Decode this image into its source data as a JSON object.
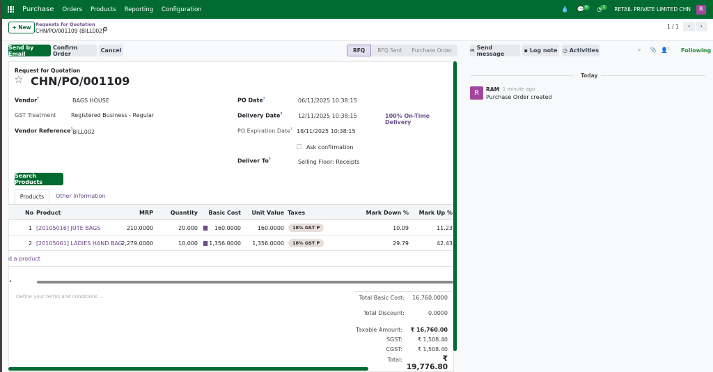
{
  "nav": {
    "app": "Purchase",
    "menu": [
      "Orders",
      "Products",
      "Reporting",
      "Configuration"
    ],
    "messages_count": "6",
    "activities_count": "2",
    "company": "RETAIL PRIVATE LIMITED CHN",
    "user_initial": "R"
  },
  "control": {
    "new_label": "New",
    "breadcrumb_parent": "Requests for Quotation",
    "breadcrumb_current": "CHN/PO/001109 (BILL002)",
    "pager": "1 / 1"
  },
  "actions": {
    "send_email": "Send by Email",
    "confirm": "Confirm Order",
    "cancel": "Cancel"
  },
  "status": {
    "steps": [
      "RFQ",
      "RFQ Sent",
      "Purchase Order"
    ],
    "active": "RFQ"
  },
  "form": {
    "doc_type": "Request for Quotation",
    "name": "CHN/PO/001109",
    "vendor_label": "Vendor",
    "vendor": "BAGS HOUSE",
    "gst_label": "GST Treatment",
    "gst": "Registered Business - Regular",
    "vendor_ref_label": "Vendor Reference",
    "vendor_ref": "BILL002",
    "po_date_label": "PO Date",
    "po_date": "06/11/2025 10:38:15",
    "delivery_date_label": "Delivery Date",
    "delivery_date": "12/11/2025 10:38:15",
    "on_time": "100% On-Time Delivery",
    "expiration_label": "PO Expiration Date",
    "expiration": "18/11/2025 10:38:15",
    "ask_confirmation": "Ask confirmation",
    "deliver_to_label": "Deliver To",
    "deliver_to": "Selling Floor: Receipts",
    "search_products": "Search Products",
    "tabs": [
      "Products",
      "Other Information"
    ]
  },
  "table": {
    "headers": [
      "No",
      "Product",
      "MRP",
      "Quantity",
      "Basic Cost",
      "Unit Value",
      "Taxes",
      "Mark Down %",
      "Mark Up %"
    ],
    "rows": [
      {
        "no": "1",
        "product": "[20105016] JUTE BAGS",
        "mrp": "210.0000",
        "qty": "20.000",
        "basic": "160.0000",
        "unit": "160.0000",
        "tax": "18% GST P",
        "down": "10.09",
        "up": "11.23"
      },
      {
        "no": "2",
        "product": "[20105061] LADIES HAND BAG",
        "mrp": "2,279.0000",
        "qty": "10.000",
        "basic": "1,356.0000",
        "unit": "1,356.0000",
        "tax": "18% GST P",
        "down": "29.79",
        "up": "42.43"
      }
    ],
    "add_line": "d a product"
  },
  "footer": {
    "terms_placeholder": "Define your terms and conditions ...",
    "total_basic_label": "Total Basic Cost:",
    "total_basic": "16,760.0000",
    "total_discount_label": "Total Discount:",
    "total_discount": "0.0000",
    "taxable_label": "Taxable Amount:",
    "taxable": "₹ 16,760.00",
    "sgst_label": "SGST:",
    "sgst": "₹ 1,508.40",
    "cgst_label": "CGST:",
    "cgst": "₹ 1,508.40",
    "total_label": "Total:",
    "total": "₹ 19,776.80"
  },
  "chatter": {
    "send_message": "Send message",
    "log_note": "Log note",
    "activities": "Activities",
    "followers_count": "1",
    "following": "Following",
    "today": "Today",
    "message": {
      "author": "RAM",
      "time": "- 1 minute ago",
      "body": "Purchase Order created",
      "initial": "R"
    }
  }
}
